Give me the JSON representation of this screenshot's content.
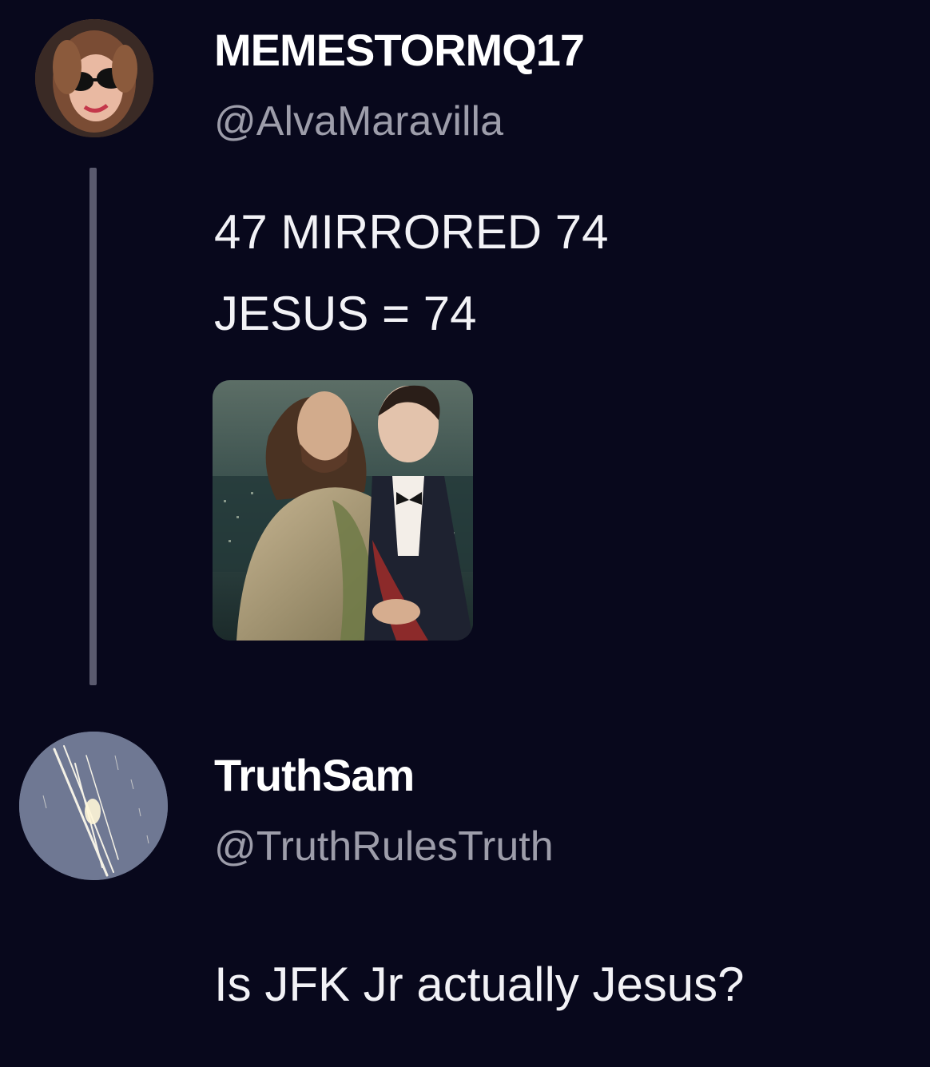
{
  "posts": [
    {
      "display_name": "MEMESTORMQ17",
      "handle": "@AlvaMaravilla",
      "body_lines": [
        "47 MIRRORED 74",
        "JESUS = 74"
      ],
      "has_media": true
    },
    {
      "display_name": "TruthSam",
      "handle": "@TruthRulesTruth",
      "body_lines": [
        "Is JFK Jr actually Jesus?"
      ]
    }
  ],
  "colors": {
    "background": "#08081c",
    "text_primary": "#ffffff",
    "text_secondary": "#9d9daa",
    "thread_line": "#5a5a6e"
  }
}
